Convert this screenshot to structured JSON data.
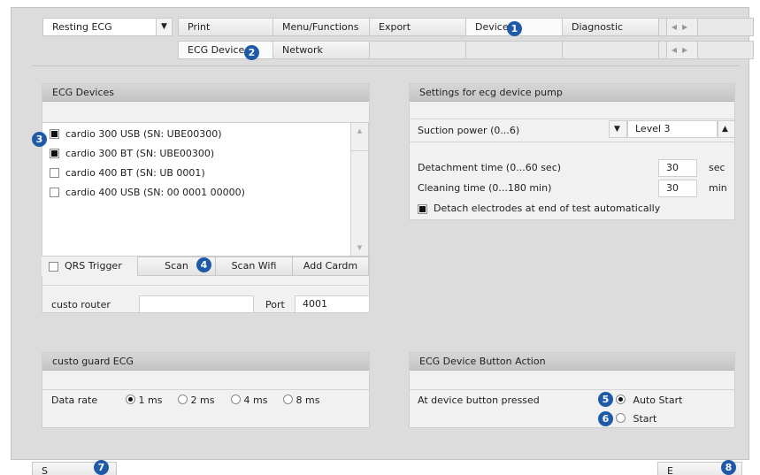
{
  "mode_select": {
    "value": "Resting ECG"
  },
  "main_tabs": [
    {
      "label": "Print"
    },
    {
      "label": "Menu/Functions"
    },
    {
      "label": "Export"
    },
    {
      "label": "Device"
    },
    {
      "label": "Diagnostic"
    },
    {
      "label": ""
    }
  ],
  "sub_tabs": [
    {
      "label": "ECG Device"
    },
    {
      "label": "Network"
    }
  ],
  "ecg_devices": {
    "title": "ECG Devices",
    "items": [
      {
        "label": "cardio 300 USB (SN: UBE00300)",
        "checked": true
      },
      {
        "label": "cardio 300 BT (SN: UBE00300)",
        "checked": true
      },
      {
        "label": "cardio 400 BT (SN: UB 0001)",
        "checked": false
      },
      {
        "label": "cardio 400 USB (SN: 00 0001 00000)",
        "checked": false
      }
    ],
    "qrs_trigger_label": "QRS Trigger",
    "scan_label": "Scan",
    "scan_wifi_label": "Scan Wifi",
    "add_cardm_label": "Add Cardm",
    "router_label": "custo router",
    "router_value": "",
    "port_label": "Port",
    "port_value": "4001"
  },
  "pump_settings": {
    "title": "Settings for ecg device pump",
    "suction_label": "Suction power (0...6)",
    "suction_value": "Level 3",
    "detachment_label": "Detachment time (0...60 sec)",
    "detachment_value": "30",
    "detachment_unit": "sec",
    "cleaning_label": "Cleaning time (0...180 min)",
    "cleaning_value": "30",
    "cleaning_unit": "min",
    "detach_auto_label": "Detach electrodes at end of test automatically",
    "detach_auto_checked": true
  },
  "guard_ecg": {
    "title": "custo guard ECG",
    "data_rate_label": "Data rate",
    "options": [
      {
        "label": "1 ms",
        "selected": true
      },
      {
        "label": "2 ms",
        "selected": false
      },
      {
        "label": "4 ms",
        "selected": false
      },
      {
        "label": "8 ms",
        "selected": false
      }
    ]
  },
  "button_action": {
    "title": "ECG Device Button Action",
    "pressed_label": "At device button pressed",
    "options": [
      {
        "label": "Auto Start",
        "selected": true
      },
      {
        "label": "Start",
        "selected": false
      }
    ]
  },
  "badges": [
    "1",
    "2",
    "3",
    "4",
    "5",
    "6",
    "7",
    "8"
  ],
  "bottom": {
    "left_label": "S",
    "right_label": "E"
  },
  "colors": {
    "badge": "#1e5aa8",
    "panel_header": "#c8c8c8",
    "background": "#dcdcdc"
  }
}
